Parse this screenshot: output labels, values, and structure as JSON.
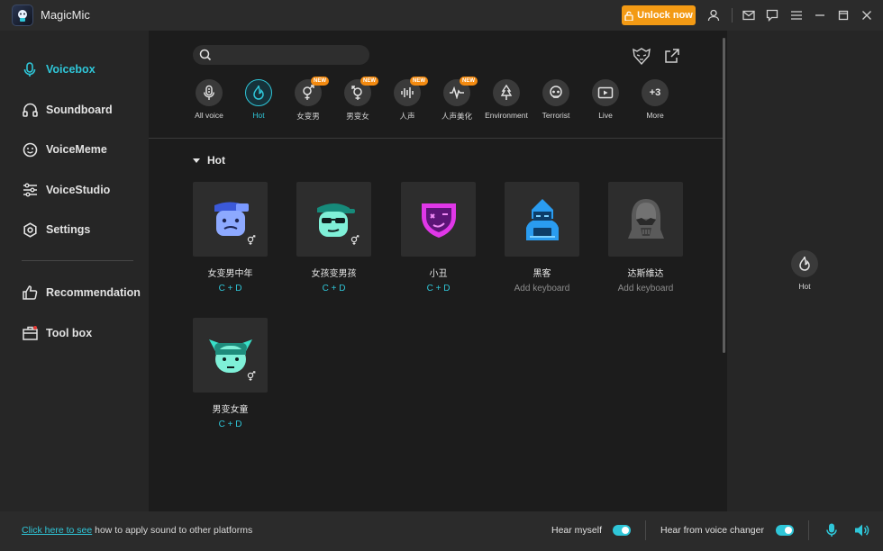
{
  "window": {
    "title": "MagicMic"
  },
  "header": {
    "unlock_label": "Unlock now"
  },
  "sidebar": {
    "items": [
      {
        "label": "Voicebox",
        "icon": "microphone-icon",
        "active": true
      },
      {
        "label": "Soundboard",
        "icon": "headphones-icon"
      },
      {
        "label": "VoiceMeme",
        "icon": "smiley-icon"
      },
      {
        "label": "VoiceStudio",
        "icon": "sliders-icon"
      },
      {
        "label": "Settings",
        "icon": "gear-icon"
      },
      {
        "label": "Recommendation",
        "icon": "thumbs-up-icon"
      },
      {
        "label": "Tool box",
        "icon": "toolbox-icon"
      }
    ]
  },
  "search": {
    "placeholder": ""
  },
  "categories": [
    {
      "label": "All voice",
      "icon": "mic-icon"
    },
    {
      "label": "Hot",
      "icon": "flame-icon",
      "active": true
    },
    {
      "label": "女变男",
      "icon": "female-male-icon",
      "badge": "NEW"
    },
    {
      "label": "男变女",
      "icon": "male-female-icon",
      "badge": "NEW"
    },
    {
      "label": "人声",
      "icon": "soundwave-icon",
      "badge": "NEW"
    },
    {
      "label": "人声美化",
      "icon": "pulse-icon",
      "badge": "NEW"
    },
    {
      "label": "Environment",
      "icon": "tree-icon"
    },
    {
      "label": "Terrorist",
      "icon": "skull-icon"
    },
    {
      "label": "Live",
      "icon": "play-screen-icon"
    },
    {
      "label": "More",
      "icon": "more-icon",
      "count": "+3"
    }
  ],
  "section": {
    "title": "Hot"
  },
  "voices": [
    {
      "name": "女变男中年",
      "key": "C + D",
      "avatar": "middle-aged-man-avatar"
    },
    {
      "name": "女孩变男孩",
      "key": "C + D",
      "avatar": "cool-boy-avatar"
    },
    {
      "name": "小丑",
      "key": "C + D",
      "avatar": "clown-mask-avatar"
    },
    {
      "name": "黑客",
      "key": "Add keyboard",
      "avatar": "hacker-avatar"
    },
    {
      "name": "达斯维达",
      "key": "Add keyboard",
      "avatar": "darth-vader-avatar"
    },
    {
      "name": "男变女童",
      "key": "C + D",
      "avatar": "little-girl-avatar"
    }
  ],
  "right_panel": {
    "label": "Hot"
  },
  "bottom": {
    "link_text": "Click here to see",
    "rest_text": " how to apply sound to other platforms",
    "hear_myself": "Hear myself",
    "hear_changer": "Hear from voice changer"
  },
  "colors": {
    "accent": "#2fc6d8",
    "unlock": "#f39a14",
    "badge": "#f38a10"
  }
}
